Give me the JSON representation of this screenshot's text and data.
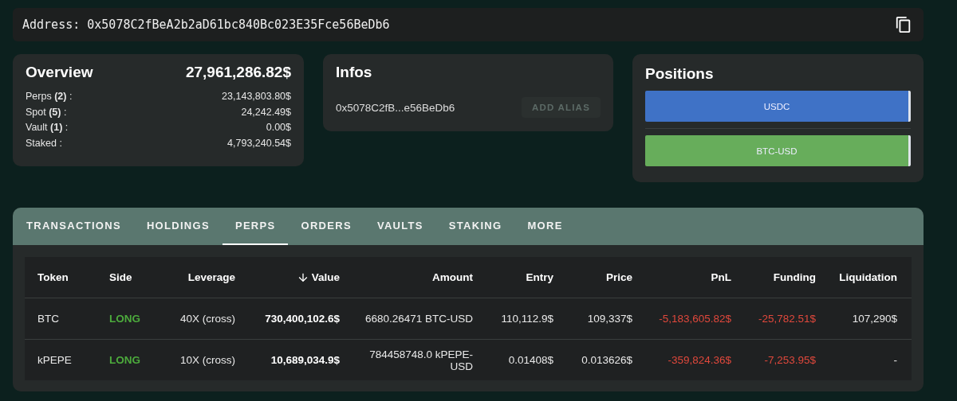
{
  "address": {
    "label": "Address:",
    "value": "0x5078C2fBeA2b2aD61bc840Bc023E35Fce56BeDb6"
  },
  "overview": {
    "title": "Overview",
    "total": "27,961,286.82$",
    "lines": [
      {
        "label": "Perps **(2)** :",
        "value": "23,143,803.80$"
      },
      {
        "label": "Spot **(5)** :",
        "value": "24,242.49$"
      },
      {
        "label": "Vault **(1)** :",
        "value": "0.00$"
      },
      {
        "label": "Staked :",
        "value": "4,793,240.54$"
      }
    ]
  },
  "infos": {
    "title": "Infos",
    "short_address": "0x5078C2fB...e56BeDb6",
    "button": "ADD ALIAS"
  },
  "positions": {
    "title": "Positions",
    "bars": [
      {
        "label": "USDC",
        "color": "#3f72c6"
      },
      {
        "label": "BTC-USD",
        "color": "#67ad5b"
      }
    ]
  },
  "tabs": [
    {
      "label": "TRANSACTIONS",
      "selected": false
    },
    {
      "label": "HOLDINGS",
      "selected": false
    },
    {
      "label": "PERPS",
      "selected": true
    },
    {
      "label": "ORDERS",
      "selected": false
    },
    {
      "label": "VAULTS",
      "selected": false
    },
    {
      "label": "STAKING",
      "selected": false
    },
    {
      "label": "MORE",
      "selected": false
    }
  ],
  "table": {
    "columns": [
      {
        "label": "Token",
        "sorted": false
      },
      {
        "label": "Side",
        "sorted": false
      },
      {
        "label": "Leverage",
        "sorted": false
      },
      {
        "label": "Value",
        "sorted": true
      },
      {
        "label": "Amount",
        "sorted": false
      },
      {
        "label": "Entry",
        "sorted": false
      },
      {
        "label": "Price",
        "sorted": false
      },
      {
        "label": "PnL",
        "sorted": false
      },
      {
        "label": "Funding",
        "sorted": false
      },
      {
        "label": "Liquidation",
        "sorted": false
      }
    ],
    "rows": [
      {
        "cells": [
          "BTC",
          "LONG",
          "40X (cross)",
          "730,400,102.6$",
          "6680.26471 BTC-USD",
          "110,112.9$",
          "109,337$",
          "-5,183,605.82$",
          "-25,782.51$",
          "107,290$"
        ],
        "long": true,
        "pnl_negative": true,
        "funding_negative": true
      },
      {
        "cells": [
          "kPEPE",
          "LONG",
          "10X (cross)",
          "10,689,034.9$",
          "784458748.0 kPEPE-USD",
          "0.01408$",
          "0.013626$",
          "-359,824.36$",
          "-7,253.95$",
          "-"
        ],
        "long": true,
        "pnl_negative": true,
        "funding_negative": true
      }
    ]
  }
}
